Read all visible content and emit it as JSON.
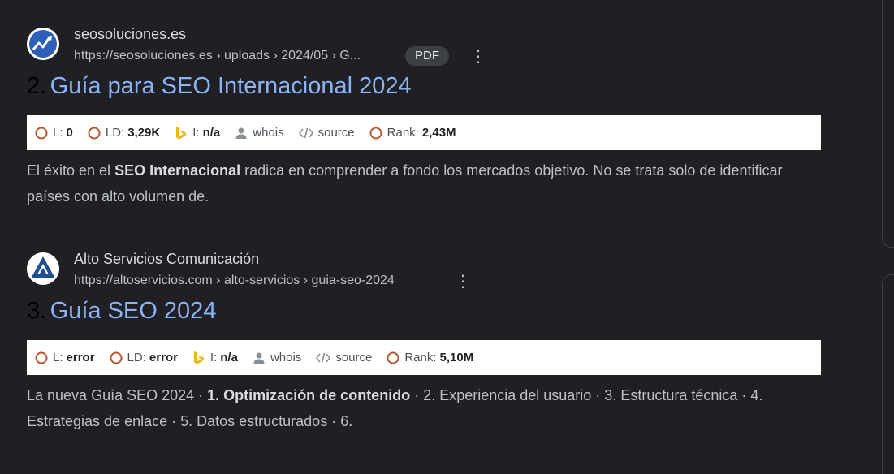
{
  "results": [
    {
      "site_name": "seosoluciones.es",
      "url": "https://seosoluciones.es › uploads › 2024/05 › G...",
      "badge": "PDF",
      "rank": "2.",
      "title": "Guía para SEO Internacional 2024",
      "metrics": {
        "l_label": "L:",
        "l_value": "0",
        "ld_label": "LD:",
        "ld_value": "3,29K",
        "i_label": "I:",
        "i_value": "n/a",
        "whois": "whois",
        "source": "source",
        "rank_label": "Rank:",
        "rank_value": "2,43M"
      },
      "snippet": {
        "pre": "El éxito en el ",
        "bold": "SEO Internacional",
        "post": " radica en comprender a fondo los mercados objetivo. No se trata solo de identificar países con alto volumen de."
      }
    },
    {
      "site_name": "Alto Servicios Comunicación",
      "url": "https://altoservicios.com › alto-servicios › guia-seo-2024",
      "rank": "3.",
      "title": "Guía SEO 2024",
      "metrics": {
        "l_label": "L:",
        "l_value": "error",
        "ld_label": "LD:",
        "ld_value": "error",
        "i_label": "I:",
        "i_value": "n/a",
        "whois": "whois",
        "source": "source",
        "rank_label": "Rank:",
        "rank_value": "5,10M"
      },
      "snippet": {
        "pre": "La nueva Guía SEO 2024 · ",
        "bold": "1. Optimización de contenido",
        "post": " · 2. Experiencia del usuario · 3. Estructura técnica · 4. Estrategias de enlace · 5. Datos estructurados · 6."
      }
    }
  ],
  "icons": {
    "circle_metric": "circle-icon",
    "bing": "bing-icon",
    "person": "person-icon",
    "code": "code-icon",
    "more": "more-vert-icon"
  },
  "colors": {
    "background": "#1f1f24",
    "link": "#8ab4f8",
    "metric_circle": "#b5562e",
    "bing": "#f5b50f"
  }
}
